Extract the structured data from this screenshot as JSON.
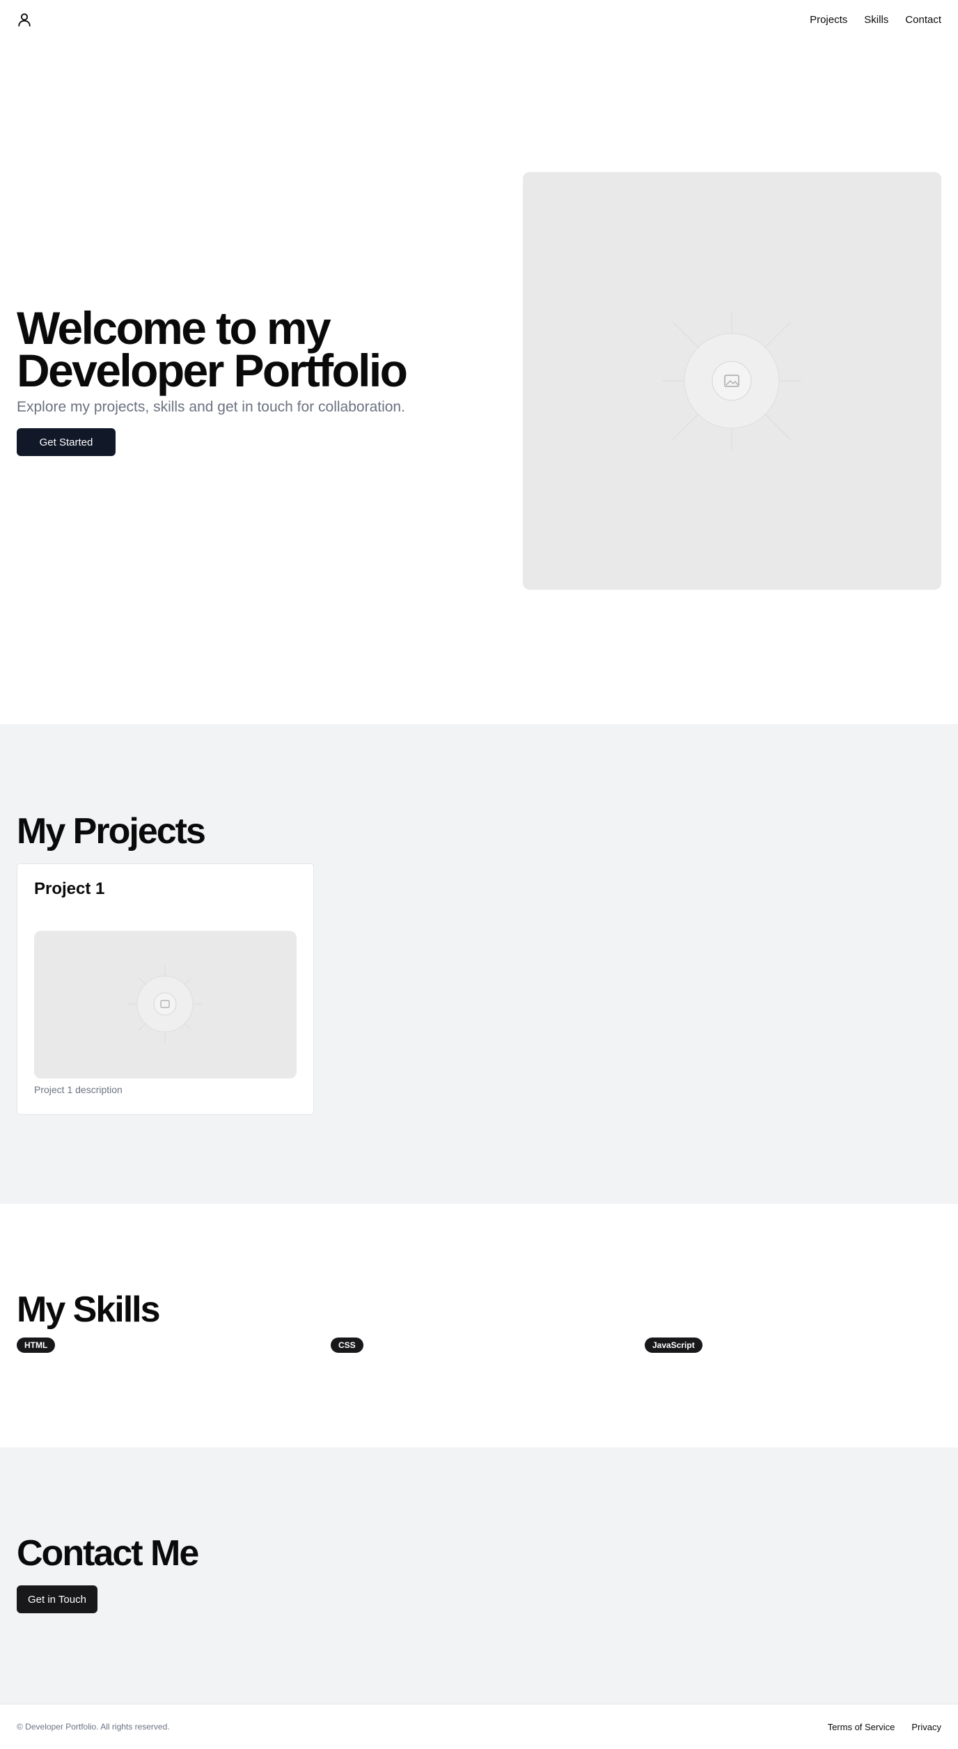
{
  "header": {
    "logo_icon": "user-icon",
    "nav": [
      {
        "label": "Projects"
      },
      {
        "label": "Skills"
      },
      {
        "label": "Contact"
      }
    ]
  },
  "hero": {
    "title_line1": "Welcome to my",
    "title_line2": "Developer Portfolio",
    "subtitle": "Explore my projects, skills and get in touch for collaboration.",
    "cta_label": "Get Started",
    "image_icon": "image-placeholder-icon"
  },
  "projects": {
    "title": "My Projects",
    "items": [
      {
        "title": "Project 1",
        "description": "Project 1 description",
        "image_icon": "image-placeholder-icon"
      }
    ]
  },
  "skills": {
    "title": "My Skills",
    "items": [
      {
        "label": "HTML"
      },
      {
        "label": "CSS"
      },
      {
        "label": "JavaScript"
      }
    ]
  },
  "contact": {
    "title": "Contact Me",
    "cta_label": "Get in Touch"
  },
  "footer": {
    "copyright": "© Developer Portfolio. All rights reserved.",
    "links": [
      {
        "label": "Terms of Service"
      },
      {
        "label": "Privacy"
      }
    ]
  },
  "colors": {
    "primary_button": "#111827",
    "dark_badge": "#18181b",
    "section_gray": "#f2f3f5",
    "muted_text": "#6b7280",
    "placeholder_bg": "#e9e9e9"
  }
}
